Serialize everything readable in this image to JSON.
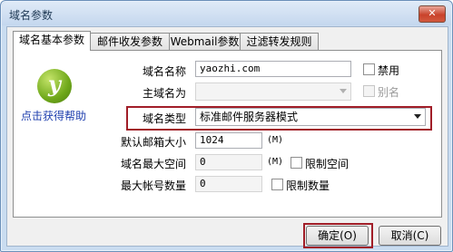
{
  "window": {
    "title": "域名参数",
    "close_label": "✕"
  },
  "tabs": [
    {
      "label": "域名基本参数"
    },
    {
      "label": "邮件收发参数"
    },
    {
      "label": "Webmail参数"
    },
    {
      "label": "过滤转发规则"
    }
  ],
  "help": {
    "link_label": "点击获得帮助",
    "logo_icon": "help-logo-icon"
  },
  "form": {
    "domain_name_label": "域名名称",
    "domain_name_value": "yaozhi.com",
    "disable_label": "禁用",
    "primary_domain_label": "主域名为",
    "primary_domain_value": "",
    "alias_label": "别名",
    "domain_type_label": "域名类型",
    "domain_type_value": "标准邮件服务器模式",
    "default_mailbox_label": "默认邮箱大小",
    "default_mailbox_value": "1024",
    "default_mailbox_unit": "(M)",
    "max_space_label": "域名最大空间",
    "max_space_value": "0",
    "max_space_unit": "(M)",
    "limit_space_label": "限制空间",
    "max_accounts_label": "最大帐号数量",
    "max_accounts_value": "0",
    "limit_count_label": "限制数量"
  },
  "buttons": {
    "ok_label": "确定(O)",
    "cancel_label": "取消(C)"
  },
  "colors": {
    "highlight_border": "#a11e28",
    "link": "#1f3fae"
  }
}
